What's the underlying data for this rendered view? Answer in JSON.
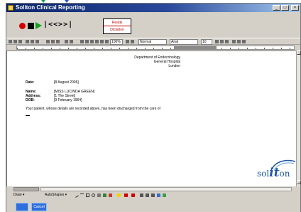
{
  "window": {
    "title": "Soliton Clinical Reporting",
    "buttons": [
      "_",
      "□",
      "×"
    ]
  },
  "player": {
    "nav_text": "|<<>>|"
  },
  "status": {
    "line1": "Ready",
    "line2": "Dictation"
  },
  "toolbar": {
    "zoom": "100%",
    "style": "Normal",
    "font": "Arial",
    "size": "10"
  },
  "document": {
    "address_lines": [
      "Department of Endocrinology",
      "General Hospital",
      "London"
    ],
    "fields": [
      {
        "label": "Date:",
        "value": "[8 August 2006]"
      },
      {
        "label": "Name:",
        "value": "[MISS LUCINDA GREEN]"
      },
      {
        "label": "Address:",
        "value": "[1 The Street]"
      },
      {
        "label": "DOB:",
        "value": "[9 February 1964]"
      }
    ],
    "body_text": "Your patient, whose details are recorded above, has been discharged from the care of"
  },
  "logo": {
    "prefix": "sol",
    "middle": "it",
    "suffix": "on"
  },
  "drawing": {
    "draw_label": "Draw ▾",
    "autoshapes_label": "AutoShapes ▾"
  },
  "footer": {
    "left_button": "",
    "right_button": "Cancel"
  },
  "colors": {
    "titlebar": "#0a246a",
    "accent_blue": "#2f6fdc",
    "status_red": "#c00000",
    "logo_blue": "#1c56a8"
  }
}
